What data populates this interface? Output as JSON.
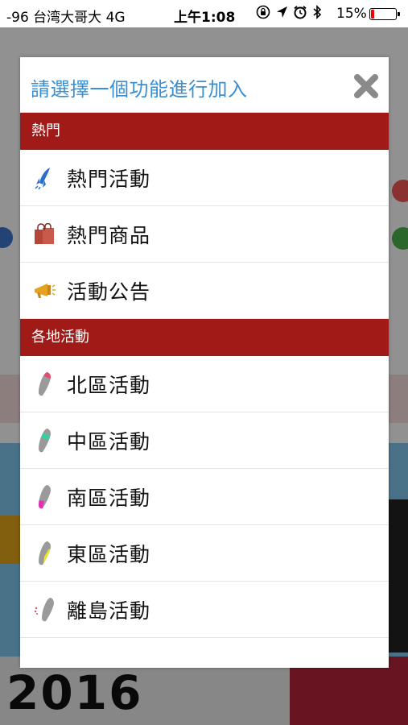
{
  "status_bar": {
    "carrier": "-96 台湾大哥大  4G",
    "time": "上午1:08",
    "battery_percent": "15%",
    "battery_level": 0.15,
    "icons": [
      "orientation-lock-icon",
      "location-arrow-icon",
      "alarm-icon",
      "bluetooth-icon"
    ]
  },
  "dialog": {
    "title": "請選擇一個功能進行加入",
    "close_icon": "close-x-icon",
    "sections": [
      {
        "header": "熱門",
        "items": [
          {
            "label": "熱門活動",
            "icon": "rocket-icon",
            "color": "#2a6fc9"
          },
          {
            "label": "熱門商品",
            "icon": "shopping-bag-icon",
            "color": "#b5473a"
          },
          {
            "label": "活動公告",
            "icon": "megaphone-icon",
            "color": "#e5a21f"
          }
        ]
      },
      {
        "header": "各地活動",
        "items": [
          {
            "label": "北區活動",
            "icon": "taiwan-north-icon",
            "color": "#e64a6a"
          },
          {
            "label": "中區活動",
            "icon": "taiwan-central-icon",
            "color": "#2fd3a2"
          },
          {
            "label": "南區活動",
            "icon": "taiwan-south-icon",
            "color": "#e22fb4"
          },
          {
            "label": "東區活動",
            "icon": "taiwan-east-icon",
            "color": "#f0e41a"
          },
          {
            "label": "離島活動",
            "icon": "taiwan-islands-icon",
            "color": "#e64a6a"
          }
        ]
      }
    ]
  },
  "background": {
    "banner_text": "2016"
  },
  "colors": {
    "title_blue": "#3a8fd1",
    "section_red": "#a01a17"
  }
}
